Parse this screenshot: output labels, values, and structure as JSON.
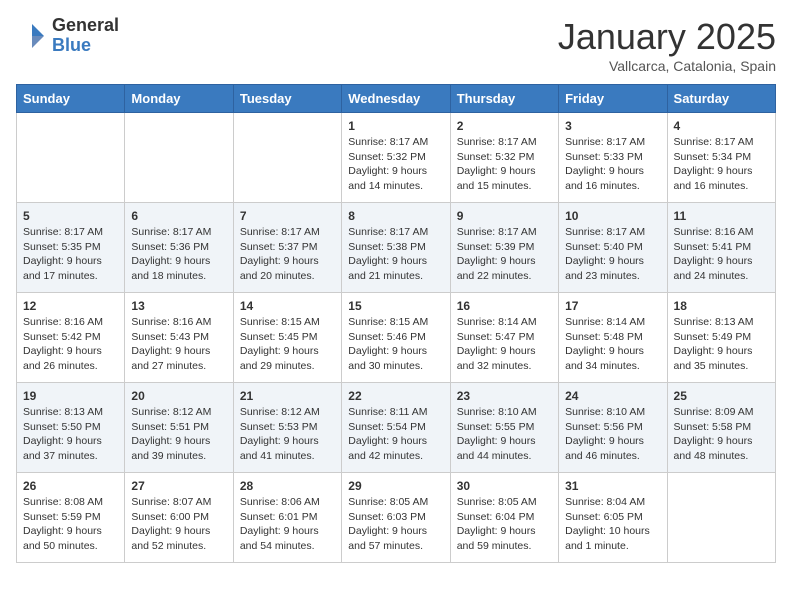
{
  "header": {
    "logo_general": "General",
    "logo_blue": "Blue",
    "month_title": "January 2025",
    "location": "Vallcarca, Catalonia, Spain"
  },
  "days_of_week": [
    "Sunday",
    "Monday",
    "Tuesday",
    "Wednesday",
    "Thursday",
    "Friday",
    "Saturday"
  ],
  "weeks": [
    {
      "days": [
        {
          "num": "",
          "info": ""
        },
        {
          "num": "",
          "info": ""
        },
        {
          "num": "",
          "info": ""
        },
        {
          "num": "1",
          "info": "Sunrise: 8:17 AM\nSunset: 5:32 PM\nDaylight: 9 hours\nand 14 minutes."
        },
        {
          "num": "2",
          "info": "Sunrise: 8:17 AM\nSunset: 5:32 PM\nDaylight: 9 hours\nand 15 minutes."
        },
        {
          "num": "3",
          "info": "Sunrise: 8:17 AM\nSunset: 5:33 PM\nDaylight: 9 hours\nand 16 minutes."
        },
        {
          "num": "4",
          "info": "Sunrise: 8:17 AM\nSunset: 5:34 PM\nDaylight: 9 hours\nand 16 minutes."
        }
      ]
    },
    {
      "days": [
        {
          "num": "5",
          "info": "Sunrise: 8:17 AM\nSunset: 5:35 PM\nDaylight: 9 hours\nand 17 minutes."
        },
        {
          "num": "6",
          "info": "Sunrise: 8:17 AM\nSunset: 5:36 PM\nDaylight: 9 hours\nand 18 minutes."
        },
        {
          "num": "7",
          "info": "Sunrise: 8:17 AM\nSunset: 5:37 PM\nDaylight: 9 hours\nand 20 minutes."
        },
        {
          "num": "8",
          "info": "Sunrise: 8:17 AM\nSunset: 5:38 PM\nDaylight: 9 hours\nand 21 minutes."
        },
        {
          "num": "9",
          "info": "Sunrise: 8:17 AM\nSunset: 5:39 PM\nDaylight: 9 hours\nand 22 minutes."
        },
        {
          "num": "10",
          "info": "Sunrise: 8:17 AM\nSunset: 5:40 PM\nDaylight: 9 hours\nand 23 minutes."
        },
        {
          "num": "11",
          "info": "Sunrise: 8:16 AM\nSunset: 5:41 PM\nDaylight: 9 hours\nand 24 minutes."
        }
      ]
    },
    {
      "days": [
        {
          "num": "12",
          "info": "Sunrise: 8:16 AM\nSunset: 5:42 PM\nDaylight: 9 hours\nand 26 minutes."
        },
        {
          "num": "13",
          "info": "Sunrise: 8:16 AM\nSunset: 5:43 PM\nDaylight: 9 hours\nand 27 minutes."
        },
        {
          "num": "14",
          "info": "Sunrise: 8:15 AM\nSunset: 5:45 PM\nDaylight: 9 hours\nand 29 minutes."
        },
        {
          "num": "15",
          "info": "Sunrise: 8:15 AM\nSunset: 5:46 PM\nDaylight: 9 hours\nand 30 minutes."
        },
        {
          "num": "16",
          "info": "Sunrise: 8:14 AM\nSunset: 5:47 PM\nDaylight: 9 hours\nand 32 minutes."
        },
        {
          "num": "17",
          "info": "Sunrise: 8:14 AM\nSunset: 5:48 PM\nDaylight: 9 hours\nand 34 minutes."
        },
        {
          "num": "18",
          "info": "Sunrise: 8:13 AM\nSunset: 5:49 PM\nDaylight: 9 hours\nand 35 minutes."
        }
      ]
    },
    {
      "days": [
        {
          "num": "19",
          "info": "Sunrise: 8:13 AM\nSunset: 5:50 PM\nDaylight: 9 hours\nand 37 minutes."
        },
        {
          "num": "20",
          "info": "Sunrise: 8:12 AM\nSunset: 5:51 PM\nDaylight: 9 hours\nand 39 minutes."
        },
        {
          "num": "21",
          "info": "Sunrise: 8:12 AM\nSunset: 5:53 PM\nDaylight: 9 hours\nand 41 minutes."
        },
        {
          "num": "22",
          "info": "Sunrise: 8:11 AM\nSunset: 5:54 PM\nDaylight: 9 hours\nand 42 minutes."
        },
        {
          "num": "23",
          "info": "Sunrise: 8:10 AM\nSunset: 5:55 PM\nDaylight: 9 hours\nand 44 minutes."
        },
        {
          "num": "24",
          "info": "Sunrise: 8:10 AM\nSunset: 5:56 PM\nDaylight: 9 hours\nand 46 minutes."
        },
        {
          "num": "25",
          "info": "Sunrise: 8:09 AM\nSunset: 5:58 PM\nDaylight: 9 hours\nand 48 minutes."
        }
      ]
    },
    {
      "days": [
        {
          "num": "26",
          "info": "Sunrise: 8:08 AM\nSunset: 5:59 PM\nDaylight: 9 hours\nand 50 minutes."
        },
        {
          "num": "27",
          "info": "Sunrise: 8:07 AM\nSunset: 6:00 PM\nDaylight: 9 hours\nand 52 minutes."
        },
        {
          "num": "28",
          "info": "Sunrise: 8:06 AM\nSunset: 6:01 PM\nDaylight: 9 hours\nand 54 minutes."
        },
        {
          "num": "29",
          "info": "Sunrise: 8:05 AM\nSunset: 6:03 PM\nDaylight: 9 hours\nand 57 minutes."
        },
        {
          "num": "30",
          "info": "Sunrise: 8:05 AM\nSunset: 6:04 PM\nDaylight: 9 hours\nand 59 minutes."
        },
        {
          "num": "31",
          "info": "Sunrise: 8:04 AM\nSunset: 6:05 PM\nDaylight: 10 hours\nand 1 minute."
        },
        {
          "num": "",
          "info": ""
        }
      ]
    }
  ]
}
